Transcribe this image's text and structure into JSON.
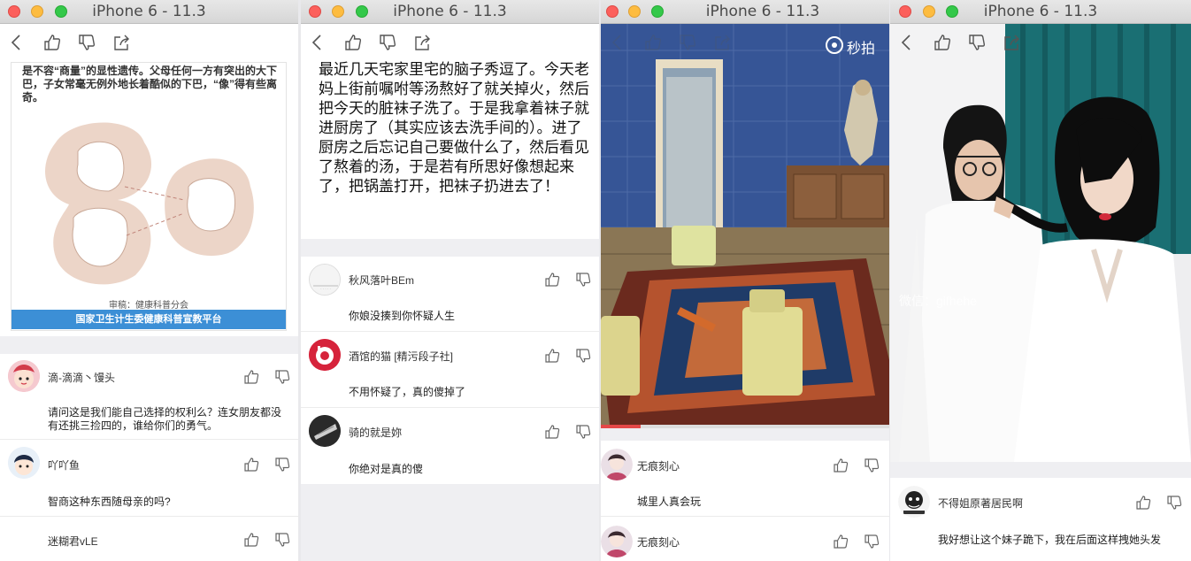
{
  "sim1": {
    "title": "iPhone 6 - 11.3",
    "image_caption": "是不容“商量”的显性遗传。父母任何一方有突出的大下巴，子女常毫无例外地长着酷似的下巴，“像”得有些离奇。",
    "image_credit": "审稿：健康科普分会",
    "image_banner": "国家卫生计生委健康科普宣教平台",
    "comments": [
      {
        "user": "滴-滴滴丶馒头",
        "text": "请问这是我们能自己选择的权利么？连女朋友都没有还挑三捡四的，谁给你们的勇气。"
      },
      {
        "user": "吖吖鱼",
        "text": "智商这种东西随母亲的吗?"
      },
      {
        "user": "迷糊君vLE",
        "text": ""
      }
    ]
  },
  "sim2": {
    "title": "iPhone 6 - 11.3",
    "post_text": "最近几天宅家里宅的脑子秀逗了。今天老妈上街前嘱咐等汤熬好了就关掉火，然后把今天的脏袜子洗了。于是我拿着袜子就进厨房了（其实应该去洗手间的）。进了厨房之后忘记自己要做什么了，然后看见了熬着的汤，于是若有所思好像想起来了，把锅盖打开，把袜子扔进去了！",
    "comments": [
      {
        "user": "秋风落叶BEm",
        "text": "你娘没揍到你怀疑人生"
      },
      {
        "user": "酒馆的猫 [精污段子社]",
        "text": "不用怀疑了，真的傻掉了"
      },
      {
        "user": "骑的就是妳",
        "text": "你绝对是真的傻"
      }
    ]
  },
  "sim3": {
    "title": "iPhone 6 - 11.3",
    "watermark": "秒拍",
    "comments": [
      {
        "user": "无痕刻心",
        "text": "城里人真会玩"
      },
      {
        "user": "无痕刻心",
        "text": ""
      }
    ]
  },
  "sim4": {
    "title": "iPhone 6 - 11.3",
    "watermark": "微信：gifhehe",
    "comments": [
      {
        "user": "不得姐原著居民啊",
        "text": "我好想让这个妹子跪下，我在后面这样拽她头发"
      }
    ]
  }
}
